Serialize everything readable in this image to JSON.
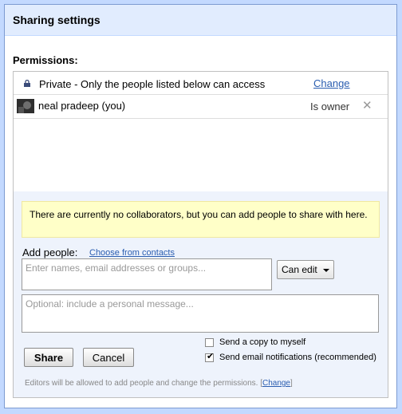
{
  "dialog": {
    "title": "Sharing settings"
  },
  "permissions": {
    "label": "Permissions:",
    "visibility": {
      "icon": "lock-icon",
      "text": "Private - Only the people listed below can access",
      "change_label": "Change"
    },
    "users": [
      {
        "name": "neal pradeep (you)",
        "role": "Is owner",
        "remove_icon": "close-icon"
      }
    ]
  },
  "notice": {
    "text": "There are currently no collaborators, but you can add people to share with here."
  },
  "add_people": {
    "label": "Add people:",
    "choose_link": "Choose from contacts",
    "input_placeholder": "Enter names, email addresses or groups...",
    "permission_select": "Can edit",
    "message_placeholder": "Optional: include a personal message..."
  },
  "options": {
    "send_copy": {
      "label": "Send a copy to myself",
      "checked": false
    },
    "send_email": {
      "label": "Send email notifications (recommended)",
      "checked": true
    }
  },
  "buttons": {
    "share": "Share",
    "cancel": "Cancel"
  },
  "footer": {
    "text": "Editors will be allowed to add people and change the permissions.",
    "open_bracket": "[",
    "link": "Change",
    "close_bracket": "]"
  },
  "colors": {
    "accent": "#c3d9ff",
    "link": "#2a5db0",
    "notice_bg": "#ffffc8"
  }
}
